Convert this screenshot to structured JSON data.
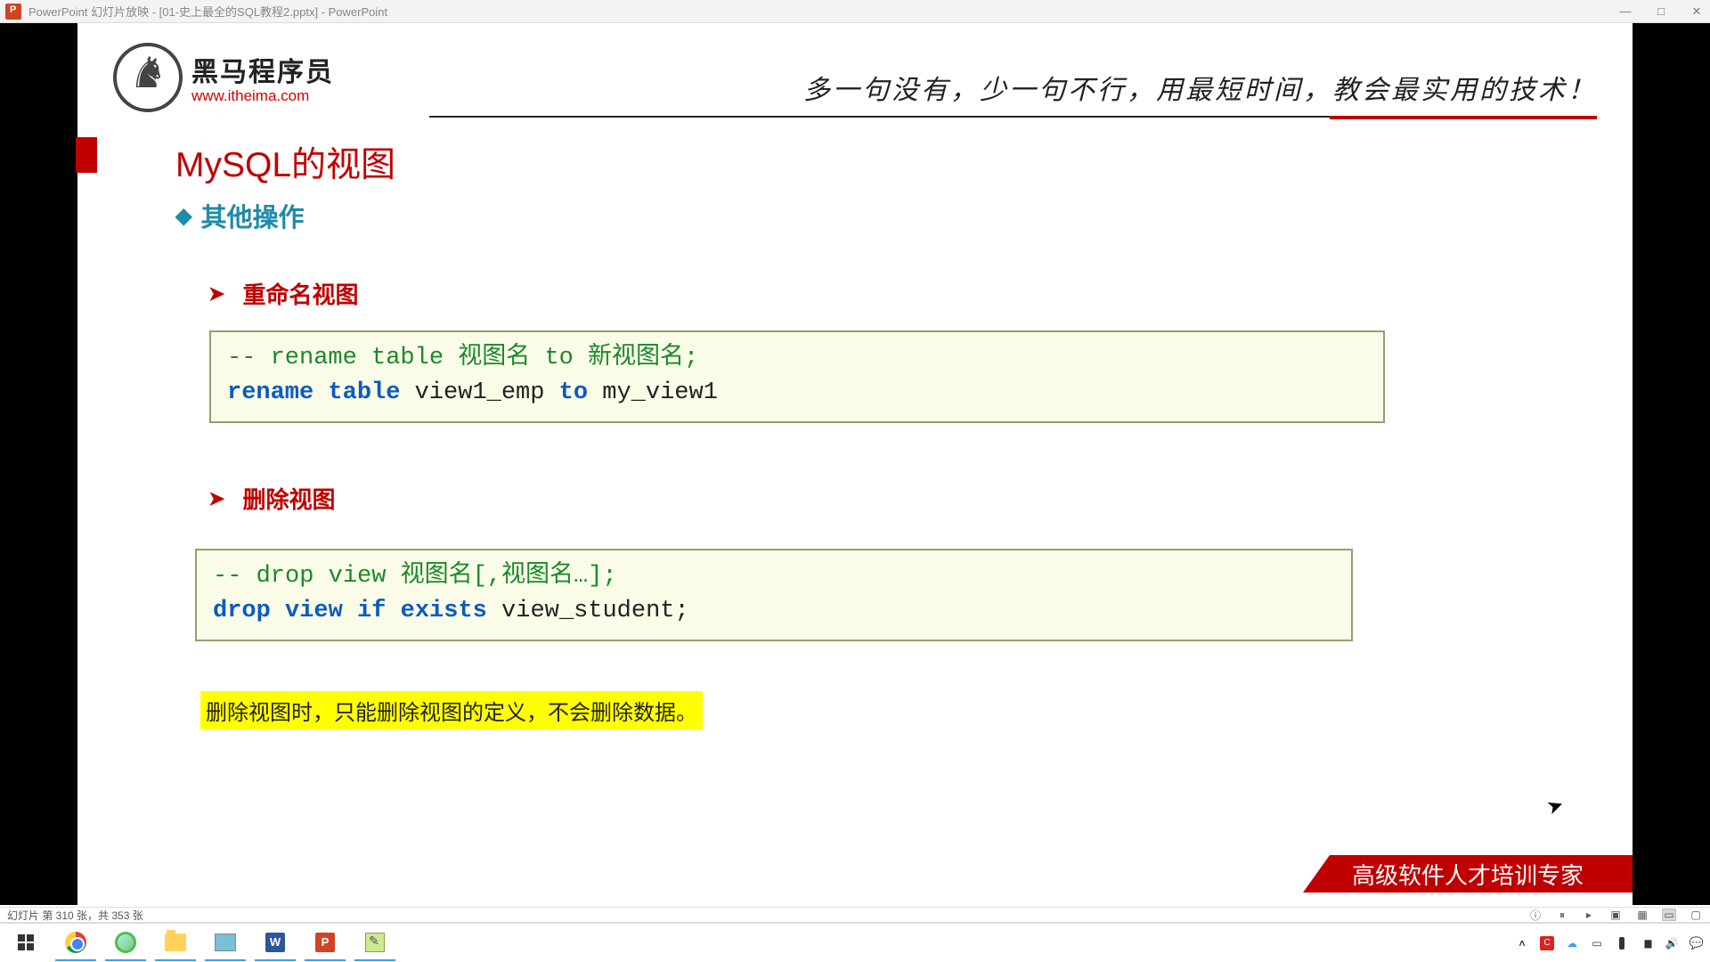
{
  "window": {
    "title": "PowerPoint 幻灯片放映 - [01-史上最全的SQL教程2.pptx] - PowerPoint"
  },
  "logo": {
    "cn": "黑马程序员",
    "url": "www.itheima.com"
  },
  "slogan": "多一句没有，少一句不行，用最短时间，教会最实用的技术！",
  "slide": {
    "title": "MySQL的视图",
    "subtitle": "其他操作",
    "sec1": "重命名视图",
    "sec2": "删除视图",
    "code1": {
      "comment": "-- rename table 视图名 to 新视图名;",
      "kw1": "rename table",
      "arg1": " view1_emp ",
      "kw2": "to",
      "arg2": " my_view1"
    },
    "code2": {
      "comment": "-- drop view 视图名[,视图名…];",
      "kw1": "drop view if exists",
      "arg1": " view_student;"
    },
    "note": "删除视图时，只能删除视图的定义，不会删除数据。",
    "footer": "高级软件人才培训专家"
  },
  "statusbar": {
    "slide_counter": "幻灯片 第 310 张，共 353 张"
  }
}
